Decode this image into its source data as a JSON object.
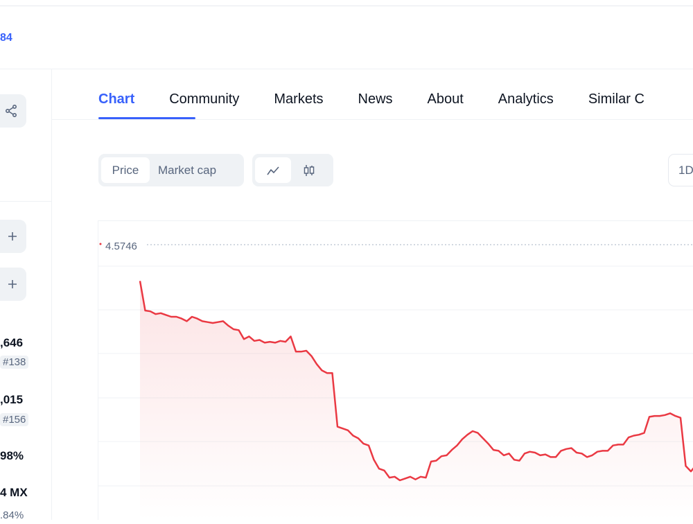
{
  "header": {
    "top_link": "84"
  },
  "sidebar": {
    "stats": [
      {
        "value": ",646",
        "rank": "#138"
      },
      {
        "value": ",015",
        "rank": "#156"
      },
      {
        "value": "98%"
      },
      {
        "value": "4 MX",
        "sub": ".84%"
      }
    ]
  },
  "tabs": [
    {
      "label": "Chart",
      "active": true
    },
    {
      "label": "Community"
    },
    {
      "label": "Markets"
    },
    {
      "label": "News"
    },
    {
      "label": "About"
    },
    {
      "label": "Analytics"
    },
    {
      "label": "Similar C"
    }
  ],
  "controls": {
    "type_toggle": [
      {
        "label": "Price",
        "selected": true
      },
      {
        "label": "Market cap"
      }
    ],
    "style_toggle": [
      {
        "icon": "line-chart-icon",
        "selected": true
      },
      {
        "icon": "candlestick-icon"
      }
    ],
    "range_label": "1D"
  },
  "chart_data": {
    "type": "line",
    "color": "#ea3943",
    "high_label": "4.5746",
    "points": [
      [
        0,
        4.528
      ],
      [
        1,
        4.495
      ],
      [
        2,
        4.494
      ],
      [
        3,
        4.491
      ],
      [
        4,
        4.492
      ],
      [
        5,
        4.49
      ],
      [
        6,
        4.488
      ],
      [
        7,
        4.488
      ],
      [
        8,
        4.486
      ],
      [
        9,
        4.483
      ],
      [
        10,
        4.488
      ],
      [
        11,
        4.486
      ],
      [
        12,
        4.483
      ],
      [
        13,
        4.482
      ],
      [
        14,
        4.481
      ],
      [
        15,
        4.482
      ],
      [
        16,
        4.483
      ],
      [
        17,
        4.478
      ],
      [
        18,
        4.474
      ],
      [
        19,
        4.473
      ],
      [
        20,
        4.463
      ],
      [
        21,
        4.466
      ],
      [
        22,
        4.461
      ],
      [
        23,
        4.462
      ],
      [
        24,
        4.459
      ],
      [
        25,
        4.46
      ],
      [
        26,
        4.459
      ],
      [
        27,
        4.461
      ],
      [
        28,
        4.46
      ],
      [
        29,
        4.466
      ],
      [
        30,
        4.449
      ],
      [
        31,
        4.449
      ],
      [
        32,
        4.45
      ],
      [
        33,
        4.444
      ],
      [
        34,
        4.435
      ],
      [
        35,
        4.428
      ],
      [
        36,
        4.425
      ],
      [
        37,
        4.425
      ],
      [
        38,
        4.365
      ],
      [
        39,
        4.363
      ],
      [
        40,
        4.361
      ],
      [
        41,
        4.355
      ],
      [
        42,
        4.352
      ],
      [
        43,
        4.346
      ],
      [
        44,
        4.344
      ],
      [
        45,
        4.328
      ],
      [
        46,
        4.318
      ],
      [
        47,
        4.316
      ],
      [
        48,
        4.308
      ],
      [
        49,
        4.309
      ],
      [
        50,
        4.305
      ],
      [
        51,
        4.307
      ],
      [
        52,
        4.309
      ],
      [
        53,
        4.306
      ],
      [
        54,
        4.309
      ],
      [
        55,
        4.308
      ],
      [
        56,
        4.326
      ],
      [
        57,
        4.327
      ],
      [
        58,
        4.332
      ],
      [
        59,
        4.333
      ],
      [
        60,
        4.339
      ],
      [
        61,
        4.344
      ],
      [
        62,
        4.351
      ],
      [
        63,
        4.356
      ],
      [
        64,
        4.36
      ],
      [
        65,
        4.358
      ],
      [
        66,
        4.352
      ],
      [
        67,
        4.346
      ],
      [
        68,
        4.339
      ],
      [
        69,
        4.338
      ],
      [
        70,
        4.333
      ],
      [
        71,
        4.335
      ],
      [
        72,
        4.328
      ],
      [
        73,
        4.327
      ],
      [
        74,
        4.335
      ],
      [
        75,
        4.337
      ],
      [
        76,
        4.336
      ],
      [
        77,
        4.333
      ],
      [
        78,
        4.334
      ],
      [
        79,
        4.331
      ],
      [
        80,
        4.331
      ],
      [
        81,
        4.338
      ],
      [
        82,
        4.34
      ],
      [
        83,
        4.341
      ],
      [
        84,
        4.336
      ],
      [
        85,
        4.335
      ],
      [
        86,
        4.331
      ],
      [
        87,
        4.333
      ],
      [
        88,
        4.337
      ],
      [
        89,
        4.338
      ],
      [
        90,
        4.338
      ],
      [
        91,
        4.344
      ],
      [
        92,
        4.345
      ],
      [
        93,
        4.345
      ],
      [
        94,
        4.353
      ],
      [
        95,
        4.355
      ],
      [
        96,
        4.356
      ],
      [
        97,
        4.358
      ],
      [
        98,
        4.376
      ],
      [
        99,
        4.377
      ],
      [
        100,
        4.377
      ],
      [
        101,
        4.378
      ],
      [
        102,
        4.38
      ],
      [
        103,
        4.377
      ],
      [
        104,
        4.375
      ],
      [
        105,
        4.321
      ],
      [
        106,
        4.315
      ],
      [
        107,
        4.322
      ],
      [
        108,
        4.325
      ]
    ],
    "y_range": [
      4.26,
      4.595
    ]
  }
}
